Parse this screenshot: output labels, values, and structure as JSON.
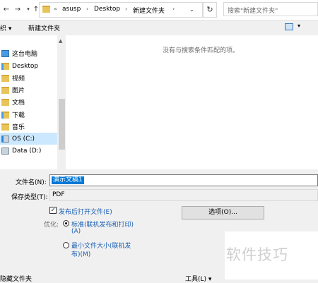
{
  "address": {
    "prefix": "«",
    "crumbs": [
      "asusp",
      "Desktop",
      "新建文件夹"
    ],
    "search_placeholder": "搜索\"新建文件夹\""
  },
  "toolbar": {
    "organize": "织 ▾",
    "new_folder": "新建文件夹"
  },
  "nav": {
    "items": [
      {
        "label": "这台电脑",
        "icon": "computer-icon"
      },
      {
        "label": "Desktop",
        "icon": "folder-icon"
      },
      {
        "label": "视频",
        "icon": "folder-icon"
      },
      {
        "label": "图片",
        "icon": "folder-icon"
      },
      {
        "label": "文档",
        "icon": "folder-icon"
      },
      {
        "label": "下载",
        "icon": "folder-icon"
      },
      {
        "label": "音乐",
        "icon": "folder-icon"
      },
      {
        "label": "OS (C:)",
        "icon": "drive-icon",
        "selected": true
      },
      {
        "label": "Data (D:)",
        "icon": "drive-icon"
      }
    ]
  },
  "content": {
    "empty_message": "没有与搜索条件匹配的项。"
  },
  "form": {
    "filename_label": "文件名(N):",
    "filename_value": "演示文稿1",
    "filetype_label": "保存类型(T):",
    "filetype_value": "PDF",
    "open_after_label": "发布后打开文件(E)",
    "open_after_checked": true,
    "optimize_label": "优化:",
    "radio_standard_line1": "标准(联机发布和打印)",
    "radio_standard_line2": "(A)",
    "radio_min_line1": "最小文件大小(联机发",
    "radio_min_line2": "布)(M)",
    "options_button": "选项(O)...",
    "tools_label": "工具(L)  ▾",
    "hide_folders": "隐藏文件夹"
  },
  "watermark": "软件技巧"
}
